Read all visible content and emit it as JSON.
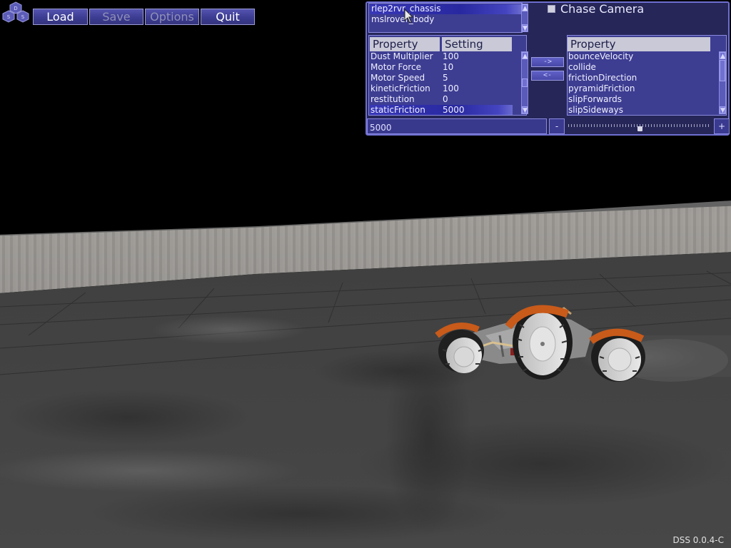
{
  "app": {
    "version": "DSS 0.0.4-C",
    "logo_letters": [
      "D",
      "S",
      "S"
    ]
  },
  "toolbar": {
    "buttons": [
      {
        "label": "Load",
        "enabled": true
      },
      {
        "label": "Save",
        "enabled": false
      },
      {
        "label": "Options",
        "enabled": false
      },
      {
        "label": "Quit",
        "enabled": true
      }
    ]
  },
  "objects": {
    "items": [
      "rlep2rvr_chassis",
      "mslrover_body"
    ],
    "selected_index": 0
  },
  "chase_camera": {
    "label": "Chase Camera",
    "checked": false
  },
  "settings_table": {
    "headers": [
      "Property",
      "Setting"
    ],
    "rows": [
      [
        "Dust Multiplier",
        "100"
      ],
      [
        "Motor Force",
        "10"
      ],
      [
        "Motor Speed",
        "5"
      ],
      [
        "kineticFriction",
        "100"
      ],
      [
        "restitution",
        "0"
      ],
      [
        "staticFriction",
        "5000"
      ]
    ],
    "selected_index": 5
  },
  "transfer": {
    "add_label": "->",
    "remove_label": "<-"
  },
  "available_table": {
    "header": "Property",
    "rows": [
      "bounceVelocity",
      "collide",
      "frictionDirection",
      "pyramidFriction",
      "slipForwards",
      "slipSideways"
    ]
  },
  "value_editor": {
    "value": "5000",
    "minus_label": "-",
    "plus_label": "+",
    "slider_position": 0.5
  },
  "colors": {
    "panel_bg": "#4646a0",
    "selection": "#2828a0",
    "header_bg": "#c9c9d8",
    "rover_orange": "#c85a1a",
    "sky": "#000000",
    "terrain": "#444444"
  },
  "scene": {
    "sky_icon": "night-sky",
    "vehicle_icon": "rover-vehicle",
    "terrain_icon": "lunar-terrain"
  }
}
